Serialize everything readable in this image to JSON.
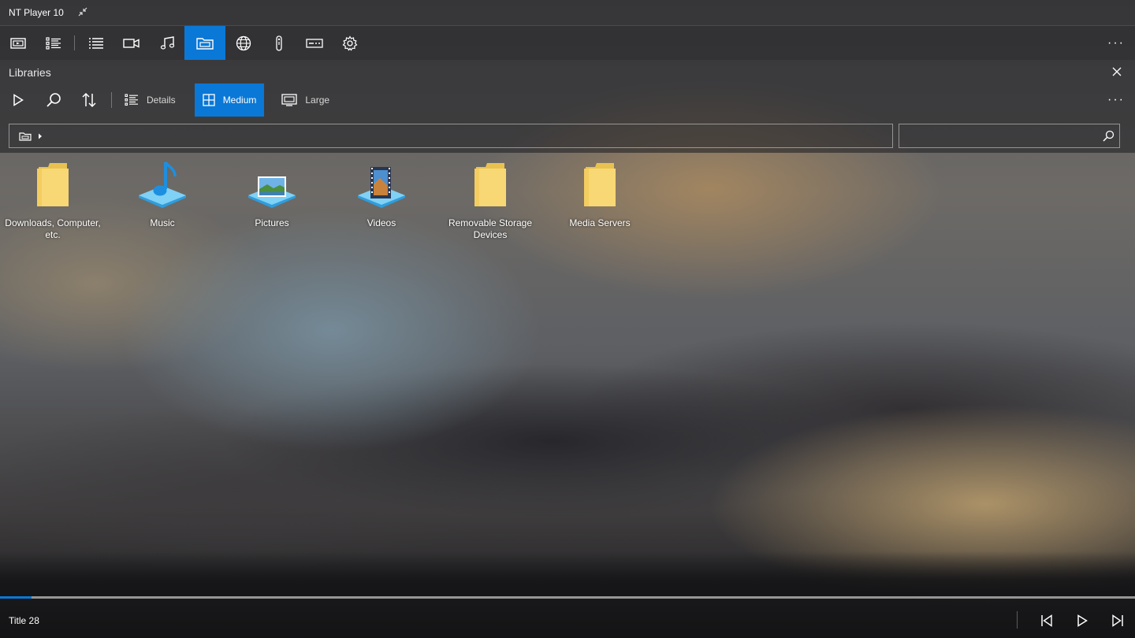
{
  "app": {
    "title": "NT Player 10"
  },
  "main_toolbar": {
    "items": [
      {
        "icon": "now-playing-icon"
      },
      {
        "icon": "playlist-icon"
      },
      {
        "icon": "list-icon"
      },
      {
        "icon": "video-icon"
      },
      {
        "icon": "music-icon"
      },
      {
        "icon": "libraries-icon",
        "active": true
      },
      {
        "icon": "globe-icon"
      },
      {
        "icon": "remote-icon"
      },
      {
        "icon": "subtitles-icon"
      },
      {
        "icon": "settings-icon"
      }
    ],
    "more_label": "···"
  },
  "panel": {
    "title": "Libraries",
    "toolbar": {
      "views": [
        {
          "label": "Details",
          "active": false
        },
        {
          "label": "Medium",
          "active": true
        },
        {
          "label": "Large",
          "active": false
        }
      ],
      "more_label": "···"
    },
    "search": {
      "value": ""
    }
  },
  "libraries": [
    {
      "label": "Downloads, Computer, etc.",
      "icon": "folder-icon"
    },
    {
      "label": "Music",
      "icon": "music-library-icon"
    },
    {
      "label": "Pictures",
      "icon": "pictures-library-icon"
    },
    {
      "label": "Videos",
      "icon": "videos-library-icon"
    },
    {
      "label": "Removable Storage Devices",
      "icon": "folder-icon"
    },
    {
      "label": "Media Servers",
      "icon": "folder-icon"
    }
  ],
  "player": {
    "now_playing": "Title 28",
    "progress": 0.028
  },
  "colors": {
    "accent": "#0a78d7",
    "folder": "#f5d36b"
  }
}
